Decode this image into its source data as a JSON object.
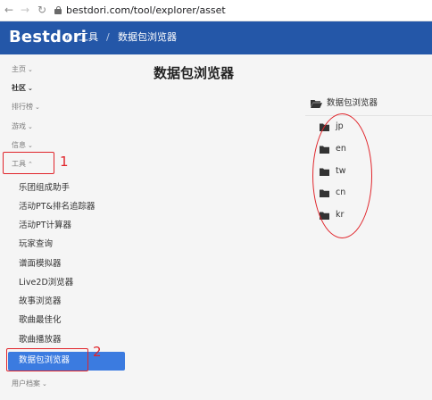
{
  "browser": {
    "url": "bestdori.com/tool/explorer/asset",
    "icons": [
      "back-icon",
      "forward-icon",
      "reload-icon",
      "lock-icon"
    ]
  },
  "header": {
    "brand": "Bestdori",
    "separator": "/",
    "crumbs": [
      "工具",
      "数据包浏览器"
    ],
    "color": "#2457a8"
  },
  "sidebar": {
    "sections": [
      {
        "label": "主页",
        "chevron": "⌄"
      },
      {
        "label": "社区",
        "chevron": "⌄"
      },
      {
        "label": "排行榜",
        "chevron": "⌄"
      },
      {
        "label": "游戏",
        "chevron": "⌄"
      },
      {
        "label": "信息",
        "chevron": "⌄"
      },
      {
        "label": "工具",
        "chevron": "⌃"
      }
    ],
    "tools": [
      "乐团组成助手",
      "活动PT&排名追踪器",
      "活动PT计算器",
      "玩家查询",
      "谱面模拟器",
      "Live2D浏览器",
      "故事浏览器",
      "歌曲最佳化",
      "歌曲播放器"
    ],
    "active": "数据包浏览器",
    "bottom": {
      "label": "用户档案",
      "chevron": "⌄"
    },
    "accent": "#3b7be0"
  },
  "main": {
    "title": "数据包浏览器",
    "root_folder": "数据包浏览器",
    "folders": [
      "jp",
      "en",
      "tw",
      "cn",
      "kr"
    ]
  },
  "annotations": {
    "labels": [
      "1",
      "2"
    ],
    "color": "#e0242a"
  }
}
